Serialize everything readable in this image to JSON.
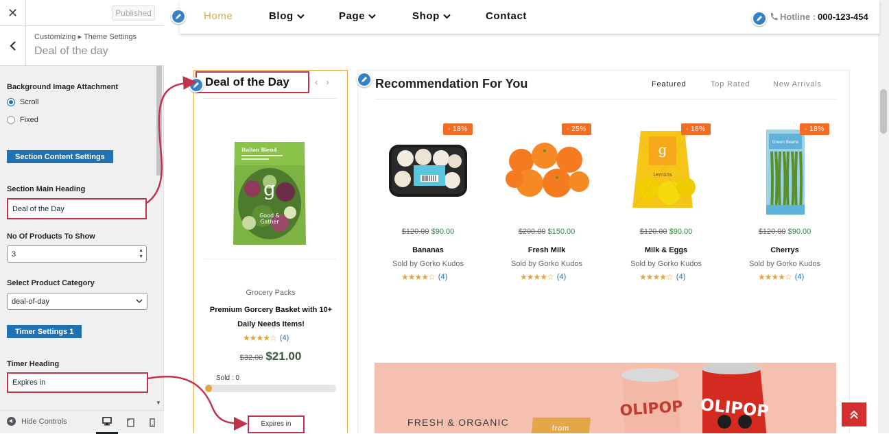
{
  "customizer": {
    "close_glyph": "✕",
    "published_label": "Published",
    "breadcrumb": "Customizing ▸ Theme Settings",
    "title": "Deal of the day",
    "bg_attachment": {
      "label": "Background Image Attachment",
      "options": [
        "Scroll",
        "Fixed"
      ],
      "selected": "Scroll"
    },
    "section_content_btn": "Section Content Settings",
    "main_heading": {
      "label": "Section Main Heading",
      "value": "Deal of the Day"
    },
    "num_products": {
      "label": "No Of Products To Show",
      "value": "3"
    },
    "category": {
      "label": "Select Product Category",
      "value": "deal-of-day"
    },
    "timer_btn": "Timer Settings 1",
    "timer_heading": {
      "label": "Timer Heading",
      "value": "Expires in"
    },
    "hide_controls": "Hide Controls"
  },
  "nav": {
    "items": [
      {
        "label": "Home",
        "active": true,
        "dropdown": false
      },
      {
        "label": "Blog",
        "active": false,
        "dropdown": true
      },
      {
        "label": "Page",
        "active": false,
        "dropdown": true
      },
      {
        "label": "Shop",
        "active": false,
        "dropdown": true
      },
      {
        "label": "Contact",
        "active": false,
        "dropdown": false
      }
    ],
    "hotline_label": "Hotline :",
    "hotline_number": "000-123-454"
  },
  "deal": {
    "heading": "Deal of the Day",
    "category": "Grocery Packs",
    "name": "Premium Gorcery Basket with 10+ Daily Needs Items!",
    "rating_count": "(4)",
    "old_price": "$32.00",
    "new_price": "$21.00",
    "sold_label": "Sold : 0",
    "progress": 0.05,
    "expires": "Expires in",
    "bag": {
      "brand": "Italian Blend",
      "logo_line1": "Good &",
      "logo_line2": "Gather"
    }
  },
  "recommend": {
    "title": "Recommendation For You",
    "tabs": [
      "Featured",
      "Top Rated",
      "New Arrivals"
    ],
    "active_tab": "Featured",
    "products": [
      {
        "discount": "- 18%",
        "old": "$120.00",
        "new": "$90.00",
        "name": "Bananas",
        "sold_by": "Sold by Gorko Kudos",
        "rating": "(4)"
      },
      {
        "discount": "- 25%",
        "old": "$200.00",
        "new": "$150.00",
        "name": "Fresh Milk",
        "sold_by": "Sold by Gorko Kudos",
        "rating": "(4)"
      },
      {
        "discount": "- 18%",
        "old": "$120.00",
        "new": "$90.00",
        "name": "Milk & Eggs",
        "sold_by": "Sold by Gorko Kudos",
        "rating": "(4)"
      },
      {
        "discount": "- 18%",
        "old": "$120.00",
        "new": "$90.00",
        "name": "Cherrys",
        "sold_by": "Sold by Gorko Kudos",
        "rating": "(4)"
      }
    ],
    "product_labels": {
      "lemons": "Lemons",
      "beans": "Green Beans"
    }
  },
  "banner": {
    "text": "FRESH & ORGANIC",
    "tag": "from",
    "can_text": "OLIPOP"
  },
  "stars": "★★★★☆",
  "colors": {
    "accent": "#e3a748",
    "highlight": "#c0334d",
    "wp_blue": "#2271b1",
    "discount": "#f26c23"
  }
}
